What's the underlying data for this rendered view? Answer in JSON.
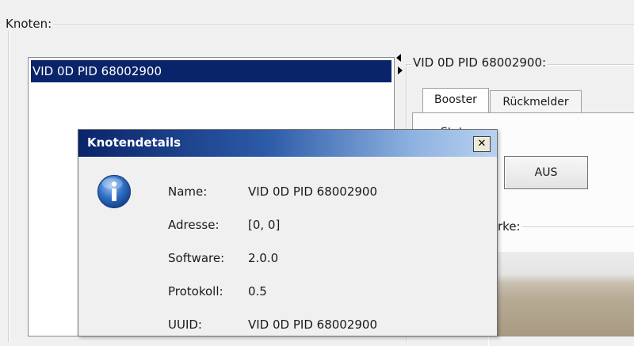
{
  "knoten_group": {
    "title": "Knoten:",
    "list": {
      "selected_item": "VID 0D PID 68002900"
    }
  },
  "right_panel": {
    "group_title": "VID 0D PID 68002900:",
    "tabs": [
      {
        "label": "Booster",
        "active": true
      },
      {
        "label": "Rückmelder",
        "active": false
      }
    ],
    "booster": {
      "status_partial_label": "Stat",
      "aus_button_label": "AUS",
      "staerke_partial_label": "rke:"
    }
  },
  "dialog": {
    "title": "Knotendetails",
    "close_label": "✕",
    "icon": "info-icon",
    "fields": [
      {
        "label": "Name:",
        "value": "VID 0D PID 68002900"
      },
      {
        "label": "Adresse:",
        "value": "[0, 0]"
      },
      {
        "label": "Software:",
        "value": "2.0.0"
      },
      {
        "label": "Protokoll:",
        "value": "0.5"
      },
      {
        "label": "UUID:",
        "value": "VID 0D PID 68002900"
      }
    ]
  },
  "colors": {
    "selection": "#0a246a",
    "title_gradient_start": "#0a246a",
    "title_gradient_end": "#b9d1ef",
    "background": "#f0f0f0"
  }
}
